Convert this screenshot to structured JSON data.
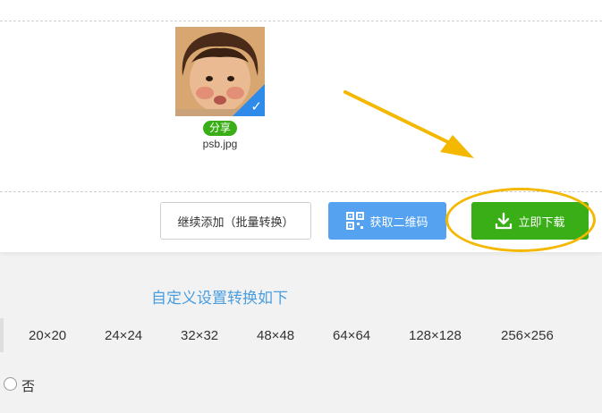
{
  "file": {
    "share_label": "分享",
    "name": "psb.jpg",
    "selected_check": "✓"
  },
  "actions": {
    "add_more_label": "继续添加（批量转换）",
    "qr_label": "获取二维码",
    "download_label": "立即下载"
  },
  "settings": {
    "title": "自定义设置转换如下",
    "sizes": [
      "20×20",
      "24×24",
      "32×32",
      "48×48",
      "64×64",
      "128×128",
      "256×256"
    ],
    "radio_no_label": "否"
  },
  "colors": {
    "accent_green": "#3aae16",
    "accent_blue": "#55a3f0",
    "check_blue": "#2f8bea",
    "highlight": "#f5b800",
    "title_blue": "#4a9ee0"
  },
  "icons": {
    "qr": "qr-code-icon",
    "download": "download-icon",
    "check": "checkmark-icon",
    "annotation": "arrow-annotation"
  }
}
